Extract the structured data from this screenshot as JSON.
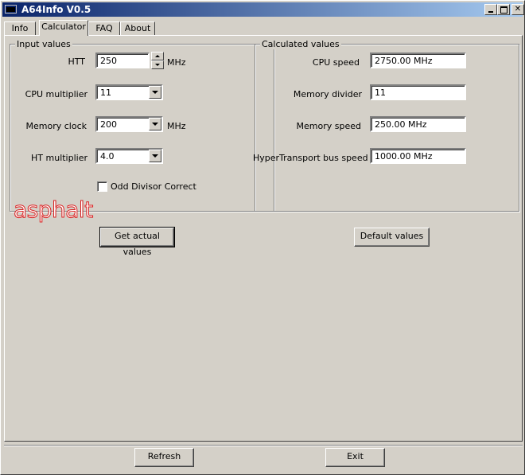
{
  "window": {
    "title": "A64Info V0.5"
  },
  "tabs": [
    {
      "label": "Info"
    },
    {
      "label": "Calculator"
    },
    {
      "label": "FAQ"
    },
    {
      "label": "About"
    }
  ],
  "input_values": {
    "group_label": "Input values",
    "htt": {
      "label": "HTT",
      "value": "250",
      "unit": "MHz"
    },
    "cpu_multiplier": {
      "label": "CPU multiplier",
      "value": "11"
    },
    "memory_clock": {
      "label": "Memory clock",
      "value": "200",
      "unit": "MHz"
    },
    "ht_multiplier": {
      "label": "HT multiplier",
      "value": "4.0"
    },
    "odd_divisor": {
      "label": "Odd Divisor Correct",
      "checked": false
    }
  },
  "calculated_values": {
    "group_label": "Calculated values",
    "cpu_speed": {
      "label": "CPU speed",
      "value": "2750.00 MHz"
    },
    "memory_divider": {
      "label": "Memory divider",
      "value": "11"
    },
    "memory_speed": {
      "label": "Memory speed",
      "value": "250.00 MHz"
    },
    "ht_bus_speed": {
      "label": "HyperTransport bus speed",
      "value": "1000.00 MHz"
    }
  },
  "watermark": "asphalt",
  "buttons": {
    "get_actual": "Get actual values",
    "default_values": "Default values",
    "refresh": "Refresh",
    "exit": "Exit"
  },
  "colors": {
    "title_start": "#0a246a",
    "title_end": "#a6caf0",
    "watermark": "#d82020"
  }
}
